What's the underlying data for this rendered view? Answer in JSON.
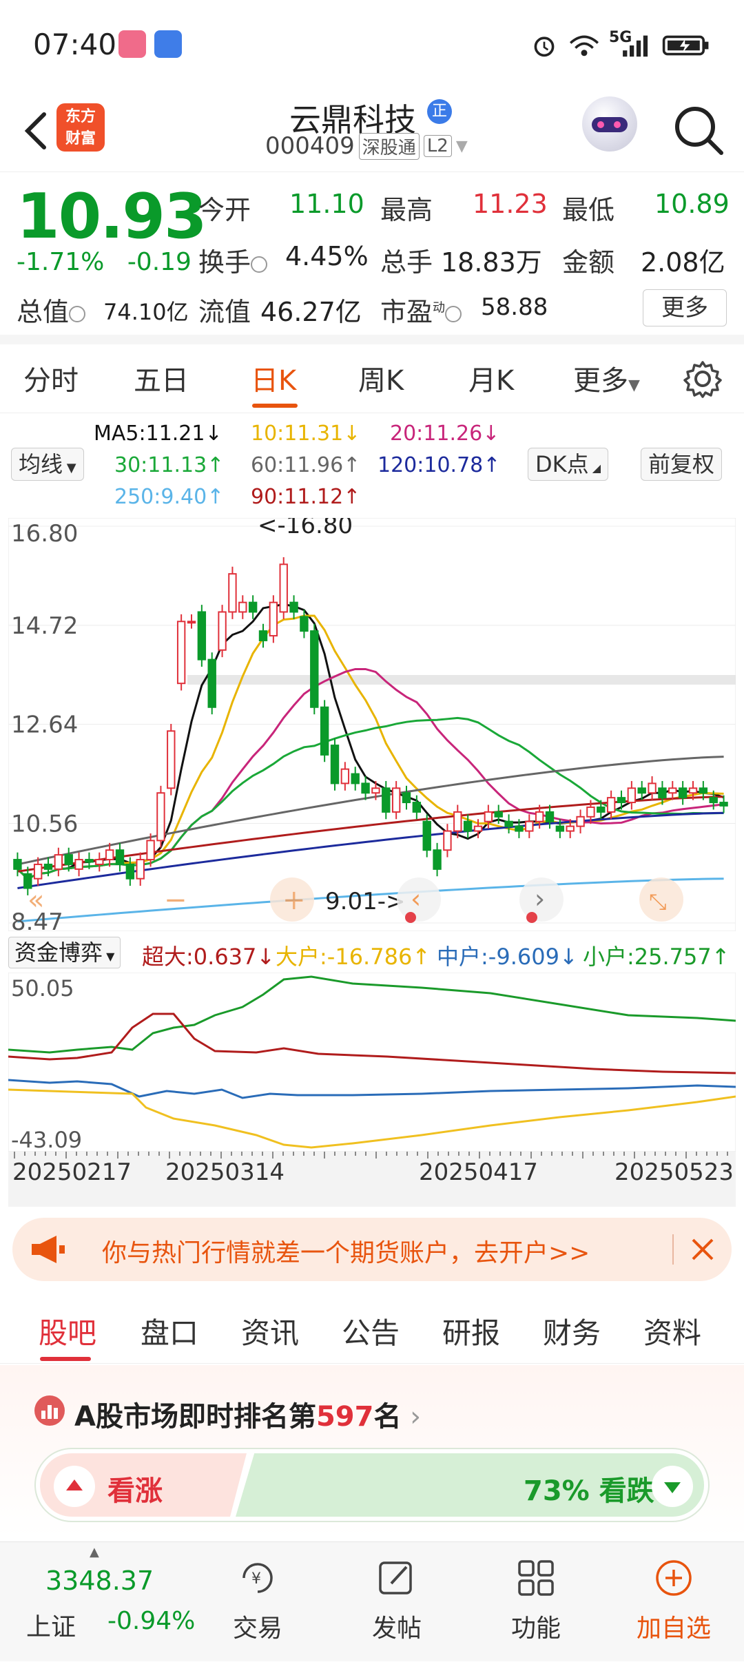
{
  "status": {
    "time": "07:40",
    "network": "5G"
  },
  "header": {
    "logo_line1": "东方",
    "logo_line2": "财富",
    "stock_name": "云鼎科技",
    "badge": "正",
    "code": "000409",
    "tag1": "深股通",
    "tag2": "L2"
  },
  "quote": {
    "price": "10.93",
    "change_pct": "-1.71%",
    "change_amt": "-0.19",
    "open_label": "今开",
    "open": "11.10",
    "high_label": "最高",
    "high": "11.23",
    "low_label": "最低",
    "low": "10.89",
    "turnover_label": "换手",
    "turnover": "4.45%",
    "volume_label": "总手",
    "volume": "18.83万",
    "amount_label": "金额",
    "amount": "2.08亿",
    "mktcap_label": "总值",
    "mktcap": "74.10亿",
    "float_label": "流值",
    "float": "46.27亿",
    "pe_label": "市盈",
    "pe_sup": "动",
    "pe": "58.88",
    "more": "更多"
  },
  "periods": [
    "分时",
    "五日",
    "日K",
    "周K",
    "月K",
    "更多"
  ],
  "active_period": "日K",
  "ma_legend": {
    "ma5": "MA5:11.21↓",
    "ma10": "10:11.31↓",
    "ma20": "20:11.26↓",
    "ma30": "30:11.13↑",
    "ma60": "60:11.96↑",
    "ma120": "120:10.78↑",
    "ma250": "250:9.40↑",
    "ma90": "90:11.12↑",
    "indicator_btn": "均线",
    "dk_btn": "DK点",
    "adjust_btn": "前复权"
  },
  "colors": {
    "up": "#e0303a",
    "down": "#0a9a2a",
    "accent": "#e8540e",
    "ma5": "#111111",
    "ma10": "#e8b400",
    "ma20": "#c8257a",
    "ma30": "#1aa838",
    "ma60": "#666666",
    "ma90": "#b01c1c",
    "ma120": "#1c2a9c",
    "ma250": "#5ab4e8"
  },
  "chart_data": {
    "type": "candlestick",
    "y_ticks": [
      "16.80",
      "14.72",
      "12.64",
      "10.56",
      "8.47"
    ],
    "ylim": [
      8.47,
      16.8
    ],
    "max_label": "<-16.80",
    "min_label": "9.01->",
    "x_labels": [
      "20250217",
      "20250314",
      "20250417",
      "20250523"
    ],
    "candles": [
      [
        9.8,
        9.6
      ],
      [
        9.5,
        9.2
      ],
      [
        9.4,
        9.7
      ],
      [
        9.7,
        9.6
      ],
      [
        9.6,
        9.9
      ],
      [
        9.9,
        9.7
      ],
      [
        9.6,
        9.8
      ],
      [
        9.8,
        9.75
      ],
      [
        9.7,
        9.8
      ],
      [
        9.8,
        10.0
      ],
      [
        10.0,
        9.7
      ],
      [
        9.7,
        9.4
      ],
      [
        9.4,
        9.8
      ],
      [
        9.8,
        10.2
      ],
      [
        10.2,
        11.2
      ],
      [
        11.3,
        12.5
      ],
      [
        13.5,
        14.8
      ],
      [
        14.8,
        14.8
      ],
      [
        15.0,
        14.0
      ],
      [
        14.0,
        13.0
      ],
      [
        14.2,
        15.0
      ],
      [
        15.0,
        15.8
      ],
      [
        15.0,
        15.2
      ],
      [
        15.2,
        15.0
      ],
      [
        14.6,
        14.4
      ],
      [
        14.5,
        15.2
      ],
      [
        15.0,
        16.0
      ],
      [
        15.2,
        15.0
      ],
      [
        14.9,
        14.6
      ],
      [
        14.6,
        13.0
      ],
      [
        13.0,
        12.0
      ],
      [
        12.2,
        11.4
      ],
      [
        11.4,
        11.7
      ],
      [
        11.6,
        11.4
      ],
      [
        11.4,
        11.2
      ],
      [
        11.2,
        11.3
      ],
      [
        11.3,
        10.8
      ],
      [
        10.8,
        11.3
      ],
      [
        11.2,
        11.0
      ],
      [
        11.0,
        10.8
      ],
      [
        10.6,
        10.0
      ],
      [
        10.0,
        9.6
      ],
      [
        10.0,
        10.4
      ],
      [
        10.4,
        10.8
      ],
      [
        10.6,
        10.4
      ],
      [
        10.4,
        10.5
      ],
      [
        10.6,
        10.8
      ],
      [
        10.8,
        10.7
      ],
      [
        10.6,
        10.5
      ],
      [
        10.5,
        10.4
      ],
      [
        10.4,
        10.6
      ],
      [
        10.6,
        10.8
      ],
      [
        10.8,
        10.6
      ],
      [
        10.5,
        10.4
      ],
      [
        10.4,
        10.5
      ],
      [
        10.5,
        10.7
      ],
      [
        10.7,
        10.9
      ],
      [
        10.9,
        10.8
      ],
      [
        10.8,
        11.1
      ],
      [
        11.1,
        11.0
      ],
      [
        11.0,
        11.3
      ],
      [
        11.3,
        11.2
      ],
      [
        11.2,
        11.4
      ],
      [
        11.3,
        11.1
      ],
      [
        11.2,
        11.3
      ],
      [
        11.3,
        11.1
      ],
      [
        11.2,
        11.3
      ],
      [
        11.3,
        11.2
      ],
      [
        11.1,
        11.0
      ],
      [
        11.0,
        10.93
      ]
    ]
  },
  "flow": {
    "selector": "资金博弈",
    "super": "超大:0.637↓",
    "large": "大户:-16.786↑",
    "mid": "中户:-9.609↓",
    "small": "小户:25.757↑",
    "y_top": "50.05",
    "y_bottom": "-43.09"
  },
  "banner": {
    "text": "你与热门行情就差一个期货账户，去开户>>"
  },
  "section_tabs": [
    "股吧",
    "盘口",
    "资讯",
    "公告",
    "研报",
    "财务",
    "资料"
  ],
  "rank": {
    "prefix": "A股市场即时排名第",
    "num": "597",
    "suffix": "名",
    "up_label": "看涨",
    "down_pct": "73%",
    "down_label": "看跌"
  },
  "bottom": {
    "index_val": "3348.37",
    "index_name": "上证",
    "index_chg": "-0.94%",
    "trade": "交易",
    "post": "发帖",
    "func": "功能",
    "add": "加自选"
  }
}
